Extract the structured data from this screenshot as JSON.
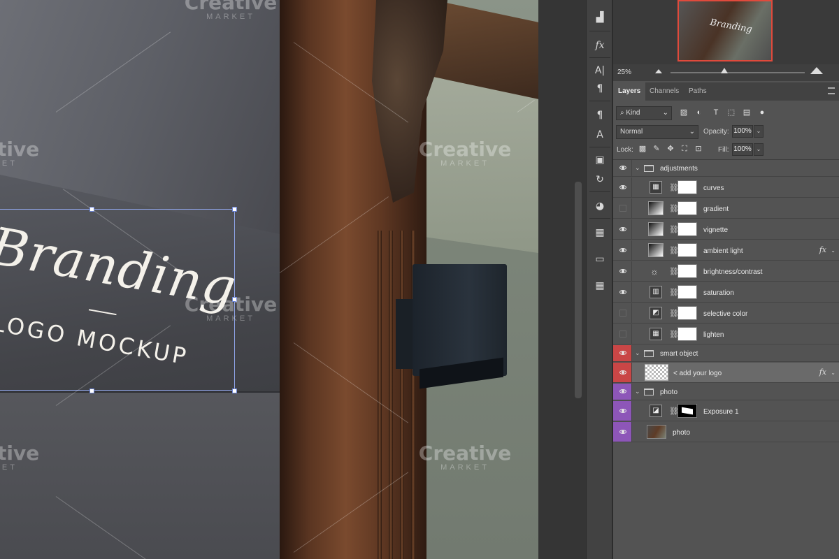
{
  "canvas": {
    "logo_title": "Branding",
    "logo_subtitle": "LOGO MOCKUP",
    "watermark_title": "Creative",
    "watermark_subtitle": "MARKET"
  },
  "navigator": {
    "thumb_text": "Branding",
    "zoom": "25%"
  },
  "toolbar": {
    "items": [
      "histogram-icon",
      "fx-icon",
      "character-icon",
      "paragraph-icon",
      "paragraph-styles-icon",
      "character-styles-icon",
      "libraries-icon",
      "history-icon",
      "swatches-icon",
      "adjustments-icon",
      "gradients-icon",
      "patterns-icon"
    ]
  },
  "panel": {
    "tabs": [
      "Layers",
      "Channels",
      "Paths"
    ],
    "active_tab": "Layers",
    "filter": {
      "kind": "Kind"
    },
    "blend_mode": "Normal",
    "opacity_label": "Opacity:",
    "opacity_value": "100%",
    "lock_label": "Lock:",
    "fill_label": "Fill:",
    "fill_value": "100%",
    "fx_label": "fx",
    "layers": [
      {
        "name": "adjustments",
        "type": "group",
        "visible": true,
        "color": "none"
      },
      {
        "name": "curves",
        "type": "adjustment",
        "visible": true
      },
      {
        "name": "gradient",
        "type": "adjustment",
        "visible": false
      },
      {
        "name": "vignette",
        "type": "adjustment",
        "visible": true
      },
      {
        "name": "ambient light",
        "type": "adjustment",
        "visible": true,
        "fx": true
      },
      {
        "name": "brightness/contrast",
        "type": "adjustment",
        "visible": true
      },
      {
        "name": "saturation",
        "type": "adjustment",
        "visible": true
      },
      {
        "name": "selective color",
        "type": "adjustment",
        "visible": false
      },
      {
        "name": "lighten",
        "type": "adjustment",
        "visible": false
      },
      {
        "name": "smart object",
        "type": "group",
        "visible": true,
        "color": "#c94646"
      },
      {
        "name": "< add your logo",
        "type": "smart",
        "visible": true,
        "color": "#c94646",
        "fx": true,
        "selected": true
      },
      {
        "name": "photo",
        "type": "group",
        "visible": true,
        "color": "#8d56b8"
      },
      {
        "name": "Exposure 1",
        "type": "adjustment",
        "visible": true,
        "color": "#8d56b8"
      },
      {
        "name": "photo",
        "type": "photo",
        "visible": true,
        "color": "#8d56b8"
      }
    ]
  },
  "colors": {
    "selection_handle": "#6c84d6",
    "nav_highlight": "#e04a3c",
    "smart_object_label": "#c94646",
    "photo_label": "#8d56b8"
  }
}
